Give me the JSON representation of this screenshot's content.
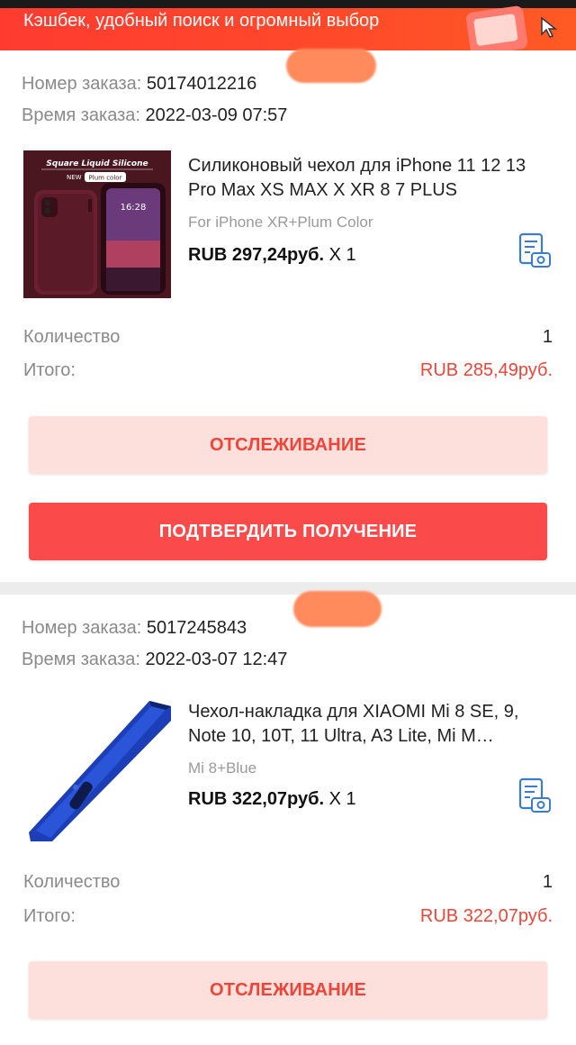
{
  "banner": {
    "text": "Кэшбек, удобный поиск и огромный выбор",
    "gift_icon": "gift-icon",
    "cursor_icon": "cursor-icon",
    "color": "#ff3b30"
  },
  "orders": [
    {
      "number_label": "Номер заказа:",
      "number_value": "50174012216",
      "time_label": "Время заказа:",
      "time_value": "2022-03-09 07:57",
      "thumbnail": {
        "header": "Square Liquid Silicone",
        "new_tag": "NEW",
        "color_tag": "Plum color",
        "clock": "16:28"
      },
      "title": "Силиконовый чехол для iPhone 11 12 13 Pro Max XS MAX X XR 8 7 PLUS",
      "variant": "For iPhone XR+Plum Color",
      "price": "RUB 297,24руб.",
      "qty_suffix": "X 1",
      "quantity_label": "Количество",
      "quantity_value": "1",
      "total_label": "Итого:",
      "total_value": "RUB 285,49руб.",
      "track_button": "ОТСЛЕЖИВАНИЕ",
      "confirm_button": "ПОДТВЕРДИТЬ ПОЛУЧЕНИЕ"
    },
    {
      "number_label": "Номер заказа:",
      "number_value": "5017245843",
      "time_label": "Время заказа:",
      "time_value": "2022-03-07 12:47",
      "title": "Чехол-накладка для XIAOMI Mi 8 SE, 9, Note 10, 10T, 11 Ultra, A3 Lite, Mi M…",
      "variant": "Mi 8+Blue",
      "price": "RUB 322,07руб.",
      "qty_suffix": "X 1",
      "quantity_label": "Количество",
      "quantity_value": "1",
      "total_label": "Итого:",
      "total_value": "RUB 322,07руб.",
      "track_button": "ОТСЛЕЖИВАНИЕ"
    }
  ],
  "colors": {
    "accent_red": "#f04438",
    "button_red": "#fa4a4a",
    "button_soft": "#fde0dc",
    "label_gray": "#8a8a8a"
  }
}
